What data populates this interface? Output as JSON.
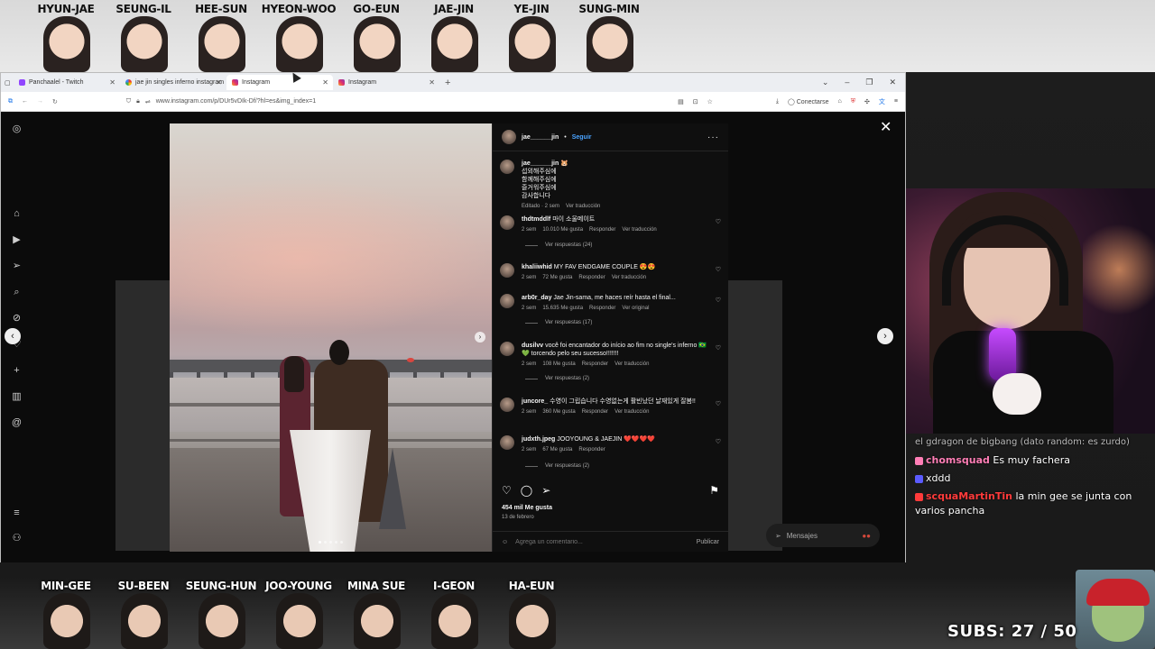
{
  "cast_top": [
    "HYUN-JAE",
    "SEUNG-IL",
    "HEE-SUN",
    "HYEON-WOO",
    "GO-EUN",
    "JAE-JIN",
    "YE-JIN",
    "SUNG-MIN"
  ],
  "cast_bottom": [
    "MIN-GEE",
    "SU-BEEN",
    "SEUNG-HUN",
    "JOO-YOUNG",
    "MINA SUE",
    "I-GEON",
    "HA-EUN"
  ],
  "browser": {
    "tabs": [
      {
        "label": "Panchaalel - Twitch",
        "icon": "twitch-icon"
      },
      {
        "label": "jae jin singles inferno instagram",
        "icon": "google-icon"
      },
      {
        "label": "Instagram",
        "icon": "instagram-icon"
      },
      {
        "label": "Instagram",
        "icon": "instagram-icon"
      }
    ],
    "url": "www.instagram.com/p/DUr5vDIk-Df/?hl=es&img_index=1",
    "connect_label": "Conectarse"
  },
  "post": {
    "username": "jae______jin",
    "follow_label": "Seguir",
    "more": "···",
    "caption_user": "jae______jin",
    "caption_emoji": "🐹",
    "caption_lines": [
      "섭외해주심에",
      "함께해주심에",
      "즐거워주심에",
      "감사합니다"
    ],
    "caption_meta": "Editado · 2 sem",
    "translate": "Ver traducción",
    "comments": [
      {
        "user": "thdtmddlf",
        "text": "마이 소울메이트",
        "time": "2 sem",
        "likes": "10.010 Me gusta",
        "reply": "Responder",
        "extra": "Ver traducción",
        "replies": "Ver respuestas (24)"
      },
      {
        "user": "khaliiwhid",
        "text": "MY FAV ENDGAME COUPLE 😍😍",
        "time": "2 sem",
        "likes": "72 Me gusta",
        "reply": "Responder",
        "extra": "Ver traducción",
        "replies": ""
      },
      {
        "user": "arb0r_day",
        "text": "Jae Jin-sama, me haces reír hasta el final...",
        "time": "2 sem",
        "likes": "15.635 Me gusta",
        "reply": "Responder",
        "extra": "Ver original",
        "replies": "Ver respuestas (17)"
      },
      {
        "user": "dusilvv",
        "text": "você foi encantador do início ao fim no single's inferno 🇧🇷 💚 torcendo pelo seu sucesso!!!!!!!",
        "time": "2 sem",
        "likes": "108 Me gusta",
        "reply": "Responder",
        "extra": "Ver traducción",
        "replies": "Ver respuestas (2)"
      },
      {
        "user": "juncore_",
        "text": "수영이 그립습니다 수영없는게 활빈났던 날재있게 잘봄!!",
        "time": "2 sem",
        "likes": "360 Me gusta",
        "reply": "Responder",
        "extra": "Ver traducción",
        "replies": ""
      },
      {
        "user": "judxth.jpeg",
        "text": "JOOYOUNG & JAEJIN ❤️❤️❤️❤️",
        "time": "2 sem",
        "likes": "67 Me gusta",
        "reply": "Responder",
        "extra": "",
        "replies": "Ver respuestas (2)"
      }
    ],
    "likes_total": "454 mil Me gusta",
    "date": "13 de febrero",
    "comment_placeholder": "Agrega un comentario...",
    "publish": "Publicar",
    "messages": "Mensajes"
  },
  "chat": [
    {
      "user": "",
      "text": "el gdragon de bigbang (dato random: es zurdo)",
      "color": "#bbbbbb"
    },
    {
      "user": "chomsquad",
      "text": "Es muy fachera",
      "color": "#ff7eb6"
    },
    {
      "user": "",
      "text": "xddd",
      "color": "#5b5bff"
    },
    {
      "user": "scquaMartinTin",
      "text": "la min gee se junta con varios pancha",
      "color": "#ff3b3b"
    }
  ],
  "subs": "SUBS: 27 / 50"
}
